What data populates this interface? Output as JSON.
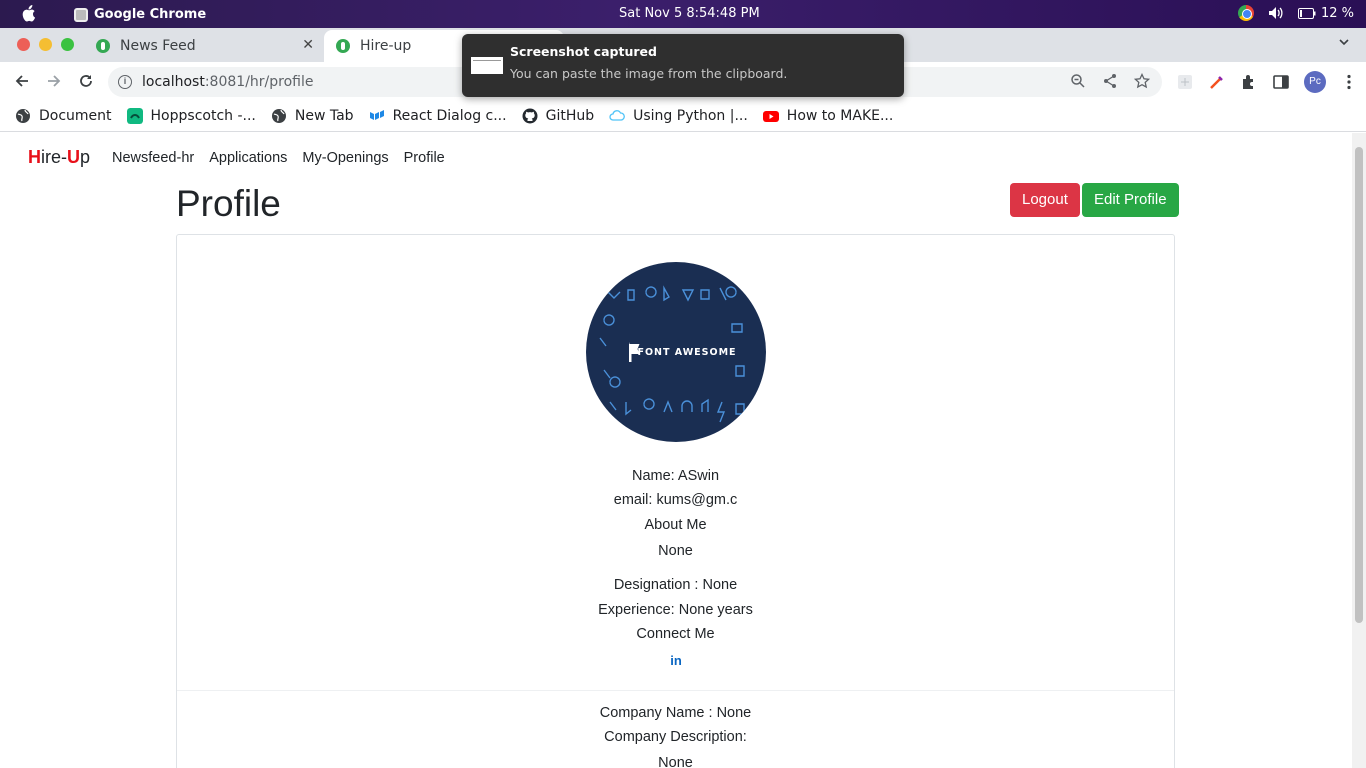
{
  "os_bar": {
    "app_name": "Google Chrome",
    "clock": "Sat Nov 5   8:54:48 PM",
    "battery": "12 %"
  },
  "tabs": [
    {
      "label": "News Feed"
    },
    {
      "label": "Hire-up"
    }
  ],
  "toolbar": {
    "url_host": "localhost",
    "url_path": ":8081/hr/profile",
    "avatar_label": "Pc"
  },
  "bookmarks": [
    {
      "label": "Document",
      "icon": "globe-icon"
    },
    {
      "label": "Hoppscotch -...",
      "icon": "hoppscotch-icon"
    },
    {
      "label": "New Tab",
      "icon": "globe-icon"
    },
    {
      "label": "React Dialog c...",
      "icon": "mui-icon"
    },
    {
      "label": "GitHub",
      "icon": "github-icon"
    },
    {
      "label": "Using Python |...",
      "icon": "cloud-icon"
    },
    {
      "label": "How to MAKE...",
      "icon": "youtube-icon"
    }
  ],
  "notification": {
    "title": "Screenshot captured",
    "body": "You can paste the image from the clipboard."
  },
  "navbar": {
    "brand_h": "H",
    "brand_ire": "ire-",
    "brand_u": "U",
    "brand_p": "p",
    "links": [
      "Newsfeed-hr",
      "Applications",
      "My-Openings",
      "Profile"
    ]
  },
  "profile": {
    "page_title": "Profile",
    "logout_label": "Logout",
    "edit_label": "Edit Profile",
    "image_text": "FONT AWESOME",
    "name_line": "Name: ASwin",
    "email_line": "email: kums@gm.c",
    "about_heading": "About Me",
    "about_value": "None",
    "designation_line": "Designation : None",
    "experience_line": "Experience: None years",
    "connect_heading": "Connect Me",
    "linkedin_label": "in",
    "company_name_line": "Company Name : None",
    "company_desc_line": "Company Description:",
    "company_desc_value": "None"
  },
  "colors": {
    "brand_red": "#e8101a",
    "logout_red": "#dc3545",
    "edit_green": "#28a745",
    "linkedin_blue": "#0a66c2",
    "profile_bg": "#1a2e52"
  }
}
